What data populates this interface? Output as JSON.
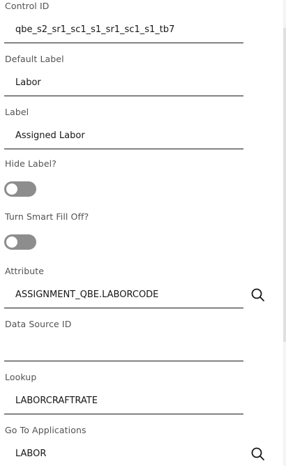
{
  "properties": {
    "control_id": {
      "label": "Control ID",
      "value": "qbe_s2_sr1_sc1_s1_sr1_sc1_s1_tb7"
    },
    "default_label": {
      "label": "Default Label",
      "value": "Labor"
    },
    "label": {
      "label": "Label",
      "value": "Assigned Labor"
    },
    "hide_label": {
      "label": "Hide Label?",
      "checked": false
    },
    "smart_fill_off": {
      "label": "Turn Smart Fill Off?",
      "checked": false
    },
    "attribute": {
      "label": "Attribute",
      "value": "ASSIGNMENT_QBE.LABORCODE",
      "icon": "search-icon"
    },
    "data_source_id": {
      "label": "Data Source ID",
      "value": ""
    },
    "lookup": {
      "label": "Lookup",
      "value": "LABORCRAFTRATE"
    },
    "go_to_applications": {
      "label": "Go To Applications",
      "value": "LABOR",
      "icon": "search-icon"
    }
  },
  "colors": {
    "label_text": "#525252",
    "value_text": "#161616",
    "underline": "#161616",
    "toggle_off": "#8d8d8d"
  }
}
